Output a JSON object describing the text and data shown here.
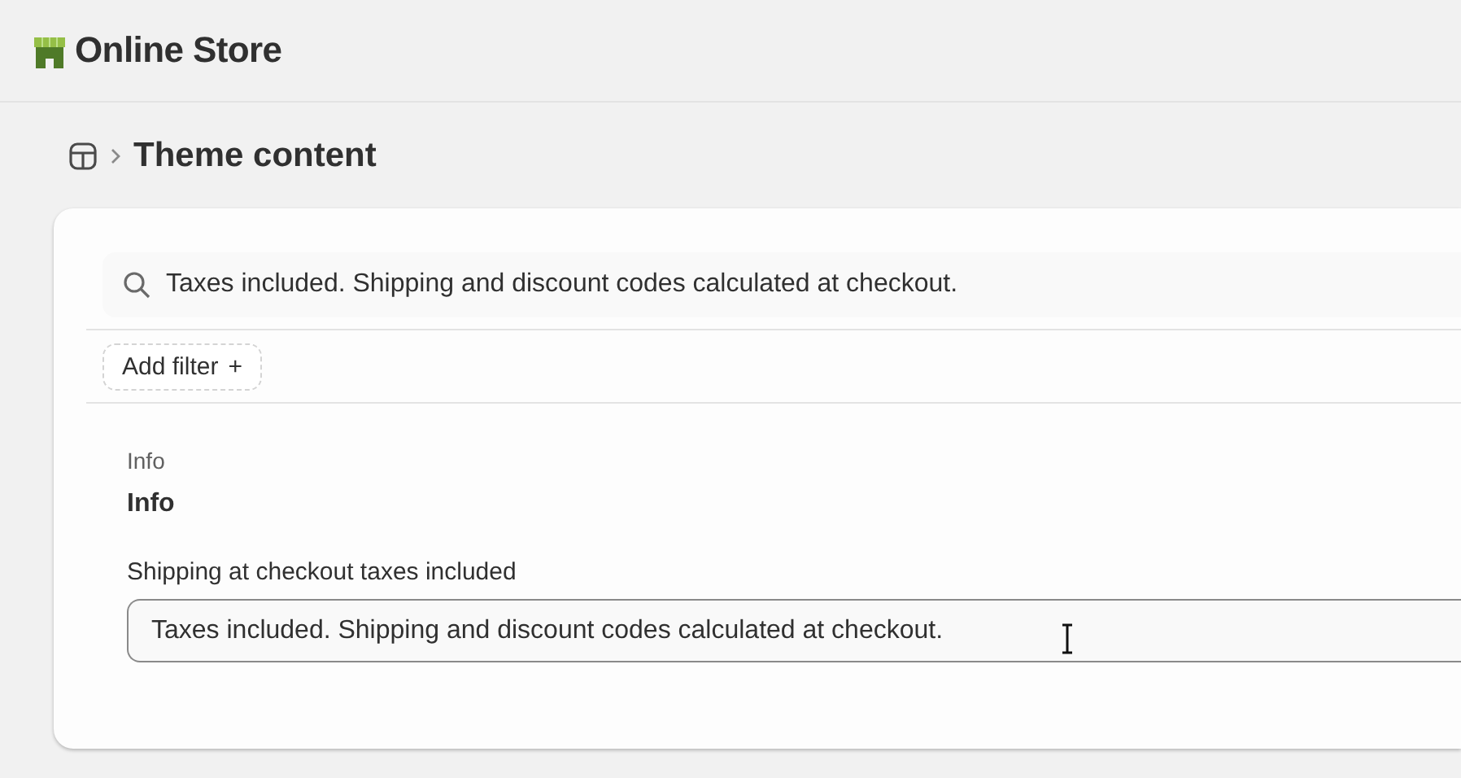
{
  "app": {
    "title": "Online Store"
  },
  "breadcrumb": {
    "title": "Theme content"
  },
  "search": {
    "value": "Taxes included. Shipping and discount codes calculated at checkout."
  },
  "filter_button": {
    "label": "Add filter",
    "icon": "+"
  },
  "section": {
    "caption": "Info",
    "heading": "Info"
  },
  "field": {
    "label": "Shipping at checkout taxes included",
    "value": "Taxes included. Shipping and discount codes calculated at checkout."
  }
}
